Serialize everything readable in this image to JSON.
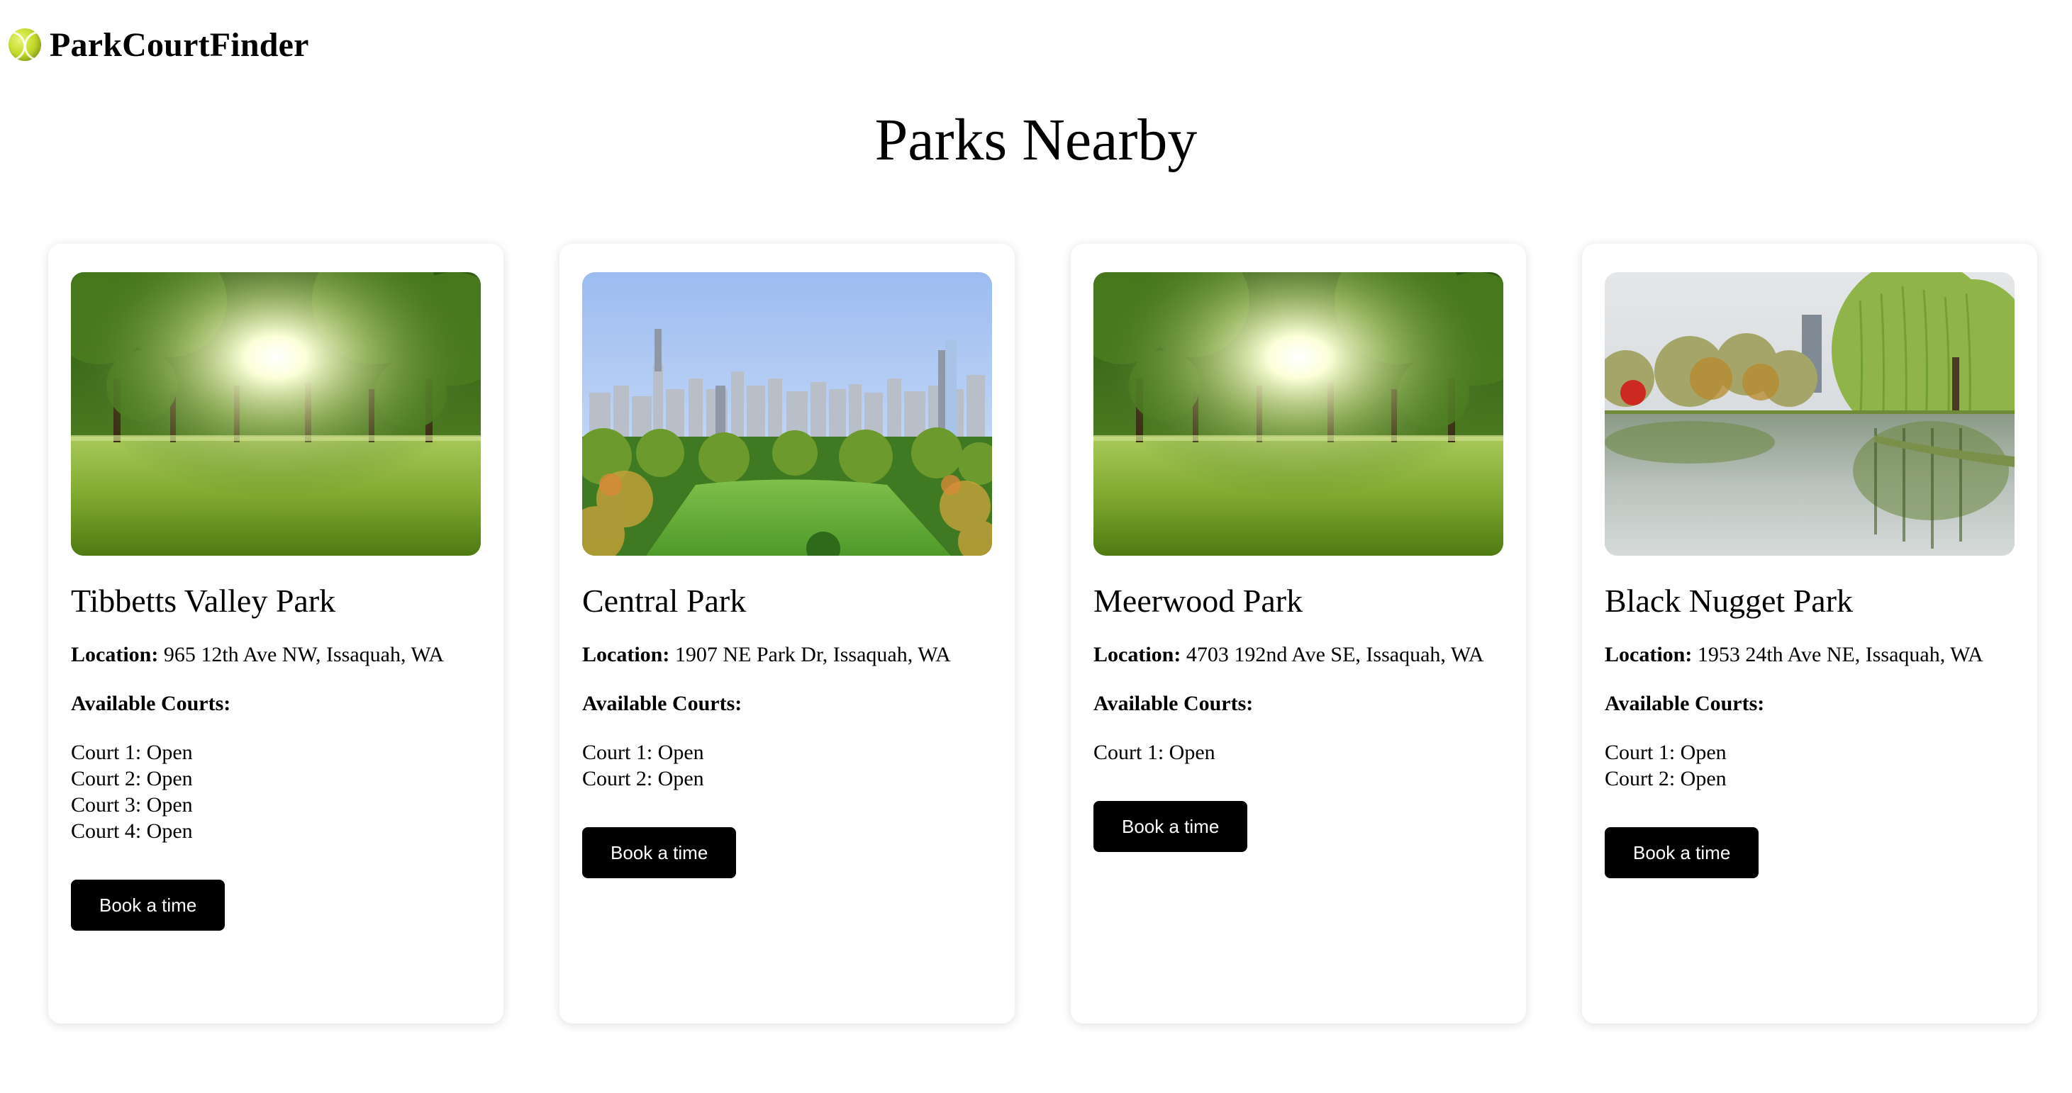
{
  "header": {
    "logo_icon": "tennis-ball-icon",
    "brand": "ParkCourtFinder"
  },
  "page": {
    "title": "Parks Nearby"
  },
  "parks": [
    {
      "name": "Tibbetts Valley Park",
      "location_label": "Location:",
      "location": "965 12th Ave NW, Issaquah, WA",
      "courts_label": "Available Courts:",
      "courts": [
        "Court 1: Open",
        "Court 2: Open",
        "Court 3: Open",
        "Court 4: Open"
      ],
      "button": "Book a time",
      "image": "sunny-park-lawn-image"
    },
    {
      "name": "Central Park",
      "location_label": "Location:",
      "location": "1907 NE Park Dr, Issaquah, WA",
      "courts_label": "Available Courts:",
      "courts": [
        "Court 1: Open",
        "Court 2: Open"
      ],
      "button": "Book a time",
      "image": "city-skyline-park-image"
    },
    {
      "name": "Meerwood Park",
      "location_label": "Location:",
      "location": "4703 192nd Ave SE, Issaquah, WA",
      "courts_label": "Available Courts:",
      "courts": [
        "Court 1: Open"
      ],
      "button": "Book a time",
      "image": "sunny-park-lawn-image"
    },
    {
      "name": "Black Nugget Park",
      "location_label": "Location:",
      "location": "1953 24th Ave NE, Issaquah, WA",
      "courts_label": "Available Courts:",
      "courts": [
        "Court 1: Open",
        "Court 2: Open"
      ],
      "button": "Book a time",
      "image": "pond-willow-park-image"
    }
  ]
}
